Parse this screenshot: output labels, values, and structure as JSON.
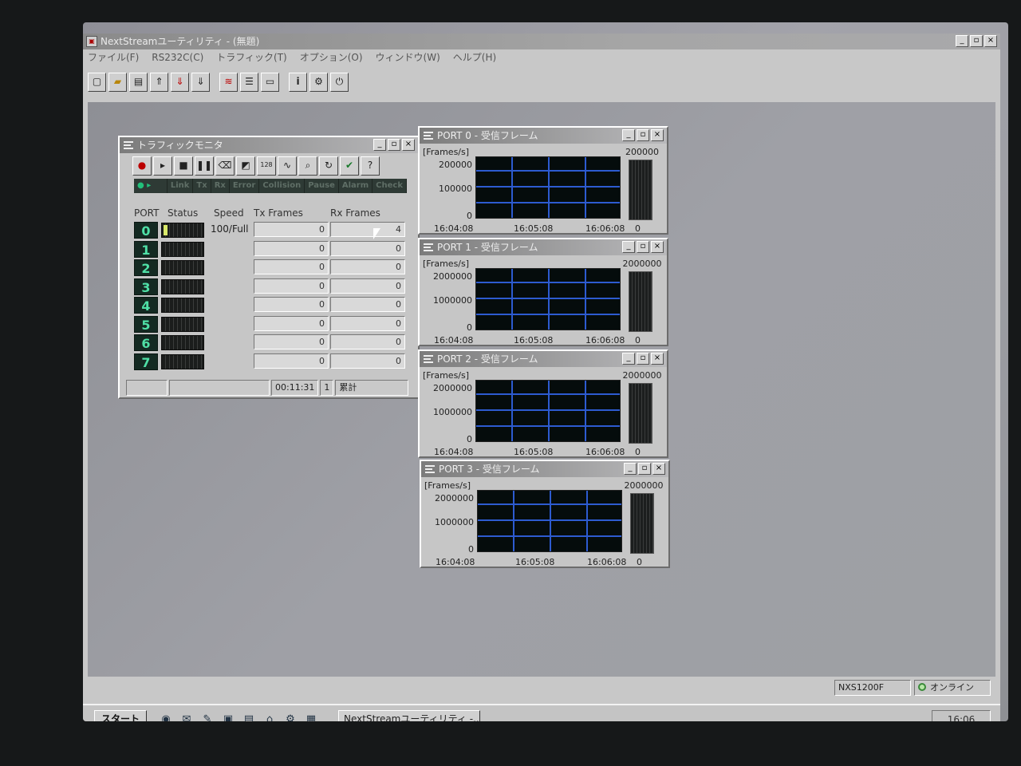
{
  "app": {
    "title": "NextStreamユーティリティ - (無題)",
    "window_buttons": [
      "_",
      "▫",
      "×"
    ],
    "menus": [
      "ファイル(F)",
      "RS232C(C)",
      "トラフィック(T)",
      "オプション(O)",
      "ウィンドウ(W)",
      "ヘルプ(H)"
    ],
    "toolbar_icons": [
      "new-file-icon",
      "open-folder-icon",
      "save-icon",
      "upload-icon",
      "download-red-icon",
      "download-icon",
      "traffic-icon",
      "list-icon",
      "display-icon",
      "info-icon",
      "settings-icon",
      "power-icon"
    ]
  },
  "traffic_monitor": {
    "title": "トラフィックモニタ",
    "status_labels": [
      "Link",
      "Tx",
      "Rx",
      "Error",
      "Collision",
      "Pause",
      "Alarm",
      "Check"
    ],
    "headers": {
      "port": "PORT",
      "status": "Status",
      "speed": "Speed",
      "tx": "Tx Frames",
      "rx": "Rx Frames"
    },
    "ports": [
      {
        "num": "0",
        "speed": "100/Full",
        "tx": "0",
        "rx": "4"
      },
      {
        "num": "1",
        "speed": "",
        "tx": "0",
        "rx": "0"
      },
      {
        "num": "2",
        "speed": "",
        "tx": "0",
        "rx": "0"
      },
      {
        "num": "3",
        "speed": "",
        "tx": "0",
        "rx": "0"
      },
      {
        "num": "4",
        "speed": "",
        "tx": "0",
        "rx": "0"
      },
      {
        "num": "5",
        "speed": "",
        "tx": "0",
        "rx": "0"
      },
      {
        "num": "6",
        "speed": "",
        "tx": "0",
        "rx": "0"
      },
      {
        "num": "7",
        "speed": "",
        "tx": "0",
        "rx": "0"
      }
    ],
    "footer": {
      "elapsed": "00:11:31",
      "count": "1",
      "mode": "累計"
    }
  },
  "graphs": [
    {
      "title": "PORT 0 - 受信フレーム",
      "units": "[Frames/s]",
      "ymax": "200000",
      "ymid": "100000",
      "ymin": "0",
      "bar_max": "200000",
      "bar_zero": "0",
      "x_ticks": [
        "16:04:08",
        "16:05:08",
        "16:06:08"
      ]
    },
    {
      "title": "PORT 1 - 受信フレーム",
      "units": "[Frames/s]",
      "ymax": "2000000",
      "ymid": "1000000",
      "ymin": "0",
      "bar_max": "2000000",
      "bar_zero": "0",
      "x_ticks": [
        "16:04:08",
        "16:05:08",
        "16:06:08"
      ]
    },
    {
      "title": "PORT 2 - 受信フレーム",
      "units": "[Frames/s]",
      "ymax": "2000000",
      "ymid": "1000000",
      "ymin": "0",
      "bar_max": "2000000",
      "bar_zero": "0",
      "x_ticks": [
        "16:04:08",
        "16:05:08",
        "16:06:08"
      ]
    },
    {
      "title": "PORT 3 - 受信フレーム",
      "units": "[Frames/s]",
      "ymax": "2000000",
      "ymid": "1000000",
      "ymin": "0",
      "bar_max": "2000000",
      "bar_zero": "0",
      "x_ticks": [
        "16:04:08",
        "16:05:08",
        "16:06:08"
      ]
    }
  ],
  "status": {
    "device": "NXS1200F",
    "connection": "オンライン"
  },
  "taskbar": {
    "start": "スタート",
    "task": "NextStreamユーティリティ -...",
    "clock": "16:06"
  },
  "colors": {
    "port_led": "#4fe0a6",
    "grid": "#2d5bd0",
    "plot_bg": "#050c0c"
  }
}
